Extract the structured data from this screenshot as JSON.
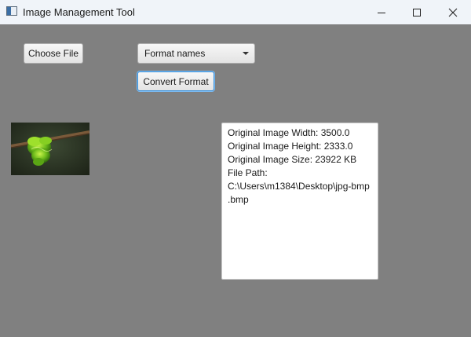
{
  "window": {
    "title": "Image Management Tool",
    "icon": "app-window-icon",
    "controls": [
      "minimize-icon",
      "maximize-icon",
      "close-icon"
    ]
  },
  "toolbar": {
    "choose_file_label": "Choose File",
    "format_combo_value": "Format names",
    "convert_label": "Convert Format"
  },
  "preview": {
    "image": "green-snake-on-branch-thumbnail"
  },
  "info": {
    "width_line": "Original Image Width: 3500.0",
    "height_line": "Original Image Height: 2333.0",
    "size_line": "Original Image Size: 23922 KB",
    "path_label": "File Path:",
    "path_line1": "C:\\Users\\m1384\\Desktop\\jpg-bmp",
    "path_line2": ".bmp"
  },
  "colors": {
    "background": "#808080",
    "titlebar": "#f0f4f9",
    "focus": "#3a8fd8"
  }
}
